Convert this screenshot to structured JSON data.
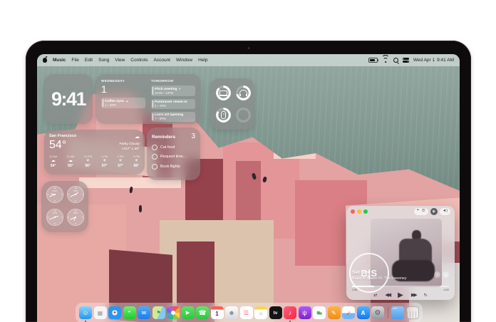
{
  "menu_bar": {
    "app_menus": [
      "Music",
      "File",
      "Edit",
      "Song",
      "View",
      "Controls",
      "Account",
      "Window",
      "Help"
    ],
    "date": "Wed Apr 1",
    "time": "9:41 AM"
  },
  "widgets": {
    "clock": {
      "time": "9:41"
    },
    "calendar": {
      "day_name": "WEDNESDAY",
      "day_number": "1",
      "today_event": {
        "title": "Coffee sync",
        "badge": "☁",
        "time": "1 – 2PM"
      },
      "tomorrow_label": "TOMORROW",
      "tomorrow_events": [
        {
          "title": "Pitch meeting",
          "badge": "✦",
          "time": "11AM – 12PM"
        },
        {
          "title": "Fundraiser check-in",
          "badge": "",
          "time": "3 – 4PM"
        },
        {
          "title": "Lou's art opening",
          "badge": "",
          "time": "7 – 8PM"
        }
      ]
    },
    "batteries": {
      "devices": [
        "macbook",
        "headphones",
        "mouse"
      ]
    },
    "weather": {
      "city": "San Francisco",
      "temp": "54°",
      "condition_icon": "☁",
      "condition": "Partly Cloudy",
      "high_low": "H:57° L:49°",
      "hours": [
        {
          "time": "10 AM",
          "icon": "☁",
          "temp": "54°"
        },
        {
          "time": "11 AM",
          "icon": "☁",
          "temp": "55°"
        },
        {
          "time": "12 PM",
          "icon": "☀",
          "temp": "56°"
        },
        {
          "time": "1 PM",
          "icon": "☀",
          "temp": "57°"
        },
        {
          "time": "2 PM",
          "icon": "☀",
          "temp": "57°"
        },
        {
          "time": "3 PM",
          "icon": "☀",
          "temp": "56°"
        }
      ]
    },
    "reminders": {
      "title": "Reminders",
      "count": "3",
      "items": [
        "Cat food",
        "Request time…",
        "Book flights"
      ]
    },
    "world_clock": {
      "cities": [
        "CUP",
        "TOK",
        "SYD",
        "PAR"
      ]
    }
  },
  "music_player": {
    "logo": "B|S",
    "track": "Set One",
    "album": "Beats In Space 01: Tim Sweeney",
    "elapsed": "1:08",
    "remaining": "-4:02",
    "progress_style": "width:23%",
    "icons": {
      "lyrics": "❝",
      "queue": "☰",
      "airplay": "◉",
      "volume": "◄)",
      "favorite": "☆",
      "more": "•••"
    },
    "controls": {
      "shuffle": "⇄",
      "previous": "◀◀",
      "play": "▶",
      "next": "▶▶",
      "repeat": "↻"
    }
  },
  "dock": {
    "apps": [
      {
        "name": "Finder",
        "glyph": "☺"
      },
      {
        "name": "Launchpad",
        "glyph": "▦"
      },
      {
        "name": "Safari",
        "glyph": "✦"
      },
      {
        "name": "Messages",
        "glyph": "❝"
      },
      {
        "name": "Mail",
        "glyph": "✉"
      },
      {
        "name": "Maps",
        "glyph": "⚑"
      },
      {
        "name": "Photos",
        "glyph": ""
      },
      {
        "name": "FaceTime",
        "glyph": "▶"
      },
      {
        "name": "Phone",
        "glyph": "☎"
      },
      {
        "name": "Calendar",
        "glyph": "1"
      },
      {
        "name": "Contacts",
        "glyph": "☻"
      },
      {
        "name": "Reminders",
        "glyph": "☰"
      },
      {
        "name": "Notes",
        "glyph": "≡"
      },
      {
        "name": "TV",
        "glyph": "tv"
      },
      {
        "name": "Music",
        "glyph": "♪"
      },
      {
        "name": "Podcasts",
        "glyph": "ψ"
      },
      {
        "name": "Numbers",
        "glyph": "▆▄"
      },
      {
        "name": "Pages",
        "glyph": "✎"
      },
      {
        "name": "Playgrounds",
        "glyph": "➶"
      },
      {
        "name": "App Store",
        "glyph": "A"
      },
      {
        "name": "Settings",
        "glyph": "⚙"
      },
      {
        "name": "Downloads",
        "glyph": ""
      },
      {
        "name": "Trash",
        "glyph": ""
      }
    ]
  },
  "colors": {
    "wall_pink": "#e2a3a2",
    "water_teal": "#7c948c",
    "traffic_red": "#ff5f57",
    "traffic_yellow": "#febc2e",
    "traffic_green": "#28c840"
  }
}
